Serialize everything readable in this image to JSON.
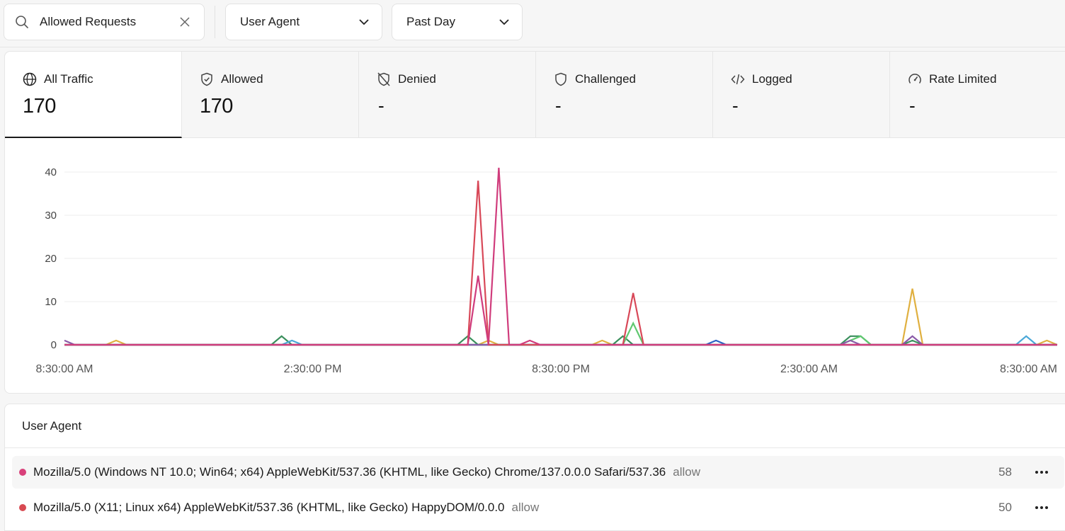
{
  "filters": {
    "search_value": "Allowed Requests",
    "group_by": "User Agent",
    "time_range": "Past Day"
  },
  "stats": [
    {
      "label": "All Traffic",
      "value": "170",
      "icon": "globe-icon",
      "active": true
    },
    {
      "label": "Allowed",
      "value": "170",
      "icon": "shield-check-icon"
    },
    {
      "label": "Denied",
      "value": "-",
      "icon": "shield-off-icon"
    },
    {
      "label": "Challenged",
      "value": "-",
      "icon": "shield-icon"
    },
    {
      "label": "Logged",
      "value": "-",
      "icon": "code-icon"
    },
    {
      "label": "Rate Limited",
      "value": "-",
      "icon": "gauge-icon"
    }
  ],
  "chart_data": {
    "type": "line",
    "title": "",
    "xlabel": "",
    "ylabel": "",
    "ylim": [
      0,
      40
    ],
    "yticks": [
      0,
      10,
      20,
      30,
      40
    ],
    "xtick_labels": [
      "8:30:00 AM",
      "2:30:00 PM",
      "8:30:00 PM",
      "2:30:00 AM",
      "8:30:00 AM"
    ],
    "x_index_of_ticks": [
      0,
      24,
      48,
      72,
      96
    ],
    "x_count": 97,
    "grid": true,
    "series": [
      {
        "color": "#e0b040",
        "points": [
          [
            0,
            0
          ],
          [
            4,
            0
          ],
          [
            5,
            1
          ],
          [
            6,
            0
          ],
          [
            39,
            0
          ],
          [
            40,
            0
          ],
          [
            41,
            1
          ],
          [
            42,
            0
          ],
          [
            51,
            0
          ],
          [
            52,
            1
          ],
          [
            53,
            0
          ],
          [
            79,
            0
          ],
          [
            80,
            0
          ],
          [
            81,
            0
          ],
          [
            82,
            13
          ],
          [
            83,
            0
          ],
          [
            94,
            0
          ],
          [
            95,
            1
          ],
          [
            96,
            0
          ]
        ]
      },
      {
        "color": "#3a8f5c",
        "points": [
          [
            0,
            0
          ],
          [
            20,
            0
          ],
          [
            21,
            2
          ],
          [
            22,
            0
          ],
          [
            38,
            0
          ],
          [
            39,
            2
          ],
          [
            40,
            0
          ],
          [
            53,
            0
          ],
          [
            54,
            2
          ],
          [
            55,
            0
          ],
          [
            75,
            0
          ],
          [
            76,
            2
          ],
          [
            77,
            2
          ],
          [
            78,
            0
          ],
          [
            81,
            0
          ],
          [
            82,
            1
          ],
          [
            83,
            0
          ],
          [
            96,
            0
          ]
        ]
      },
      {
        "color": "#4aa8d8",
        "points": [
          [
            0,
            0
          ],
          [
            21,
            0
          ],
          [
            22,
            1
          ],
          [
            23,
            0
          ],
          [
            92,
            0
          ],
          [
            93,
            2
          ],
          [
            94,
            0
          ],
          [
            96,
            0
          ]
        ]
      },
      {
        "color": "#2a62c4",
        "points": [
          [
            0,
            0
          ],
          [
            62,
            0
          ],
          [
            63,
            1
          ],
          [
            64,
            0
          ],
          [
            96,
            0
          ]
        ]
      },
      {
        "color": "#60c870",
        "points": [
          [
            0,
            0
          ],
          [
            54,
            0
          ],
          [
            55,
            5
          ],
          [
            56,
            0
          ],
          [
            75,
            0
          ],
          [
            76,
            1
          ],
          [
            77,
            2
          ],
          [
            78,
            0
          ],
          [
            96,
            0
          ]
        ]
      },
      {
        "color": "#8a5aa8",
        "points": [
          [
            0,
            1
          ],
          [
            1,
            0
          ],
          [
            75,
            0
          ],
          [
            76,
            1
          ],
          [
            77,
            0
          ],
          [
            81,
            0
          ],
          [
            82,
            2
          ],
          [
            83,
            0
          ],
          [
            96,
            0
          ]
        ]
      },
      {
        "color": "#d84858",
        "points": [
          [
            0,
            0
          ],
          [
            39,
            0
          ],
          [
            40,
            38
          ],
          [
            41,
            0
          ],
          [
            54,
            0
          ],
          [
            55,
            12
          ],
          [
            56,
            0
          ],
          [
            96,
            0
          ]
        ]
      },
      {
        "color": "#d03c7c",
        "points": [
          [
            0,
            0
          ],
          [
            39,
            0
          ],
          [
            40,
            16
          ],
          [
            41,
            0
          ],
          [
            42,
            41
          ],
          [
            43,
            0
          ],
          [
            44,
            0
          ],
          [
            45,
            1
          ],
          [
            46,
            0
          ],
          [
            96,
            0
          ]
        ]
      }
    ]
  },
  "ua_section": {
    "title": "User Agent",
    "rows": [
      {
        "dot_color": "#d8407a",
        "agent": "Mozilla/5.0 (Windows NT 10.0; Win64; x64) AppleWebKit/537.36 (KHTML, like Gecko) Chrome/137.0.0.0 Safari/537.36",
        "action": "allow",
        "count": "58"
      },
      {
        "dot_color": "#d84a52",
        "agent": "Mozilla/5.0 (X11; Linux x64) AppleWebKit/537.36 (KHTML, like Gecko) HappyDOM/0.0.0",
        "action": "allow",
        "count": "50"
      }
    ]
  }
}
